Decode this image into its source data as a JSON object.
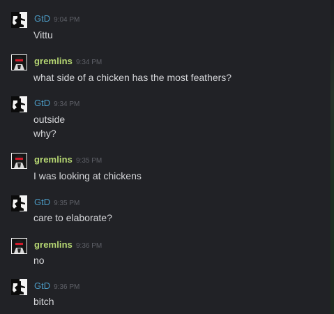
{
  "messages": [
    {
      "author": "GtD",
      "time": "9:04 PM",
      "lines": [
        "Vittu"
      ]
    },
    {
      "author": "gremlins",
      "time": "9:34 PM",
      "lines": [
        "what side of a chicken has the most feathers?"
      ]
    },
    {
      "author": "GtD",
      "time": "9:34 PM",
      "lines": [
        "outside",
        "why?"
      ]
    },
    {
      "author": "gremlins",
      "time": "9:35 PM",
      "lines": [
        "I was looking at chickens"
      ]
    },
    {
      "author": "GtD",
      "time": "9:35 PM",
      "lines": [
        "care to elaborate?"
      ]
    },
    {
      "author": "gremlins",
      "time": "9:36 PM",
      "lines": [
        "no"
      ]
    },
    {
      "author": "GtD",
      "time": "9:36 PM",
      "lines": [
        "bitch"
      ]
    }
  ],
  "icons": {
    "gtd_avatar": "gtd-avatar-icon",
    "gremlins_avatar": "gremlins-avatar-icon"
  },
  "colors": {
    "background": "#212226",
    "gtd_name": "#4c9cc6",
    "gremlins_name": "#b7d873",
    "timestamp": "#5f6168",
    "message_text": "#d6d7da"
  }
}
